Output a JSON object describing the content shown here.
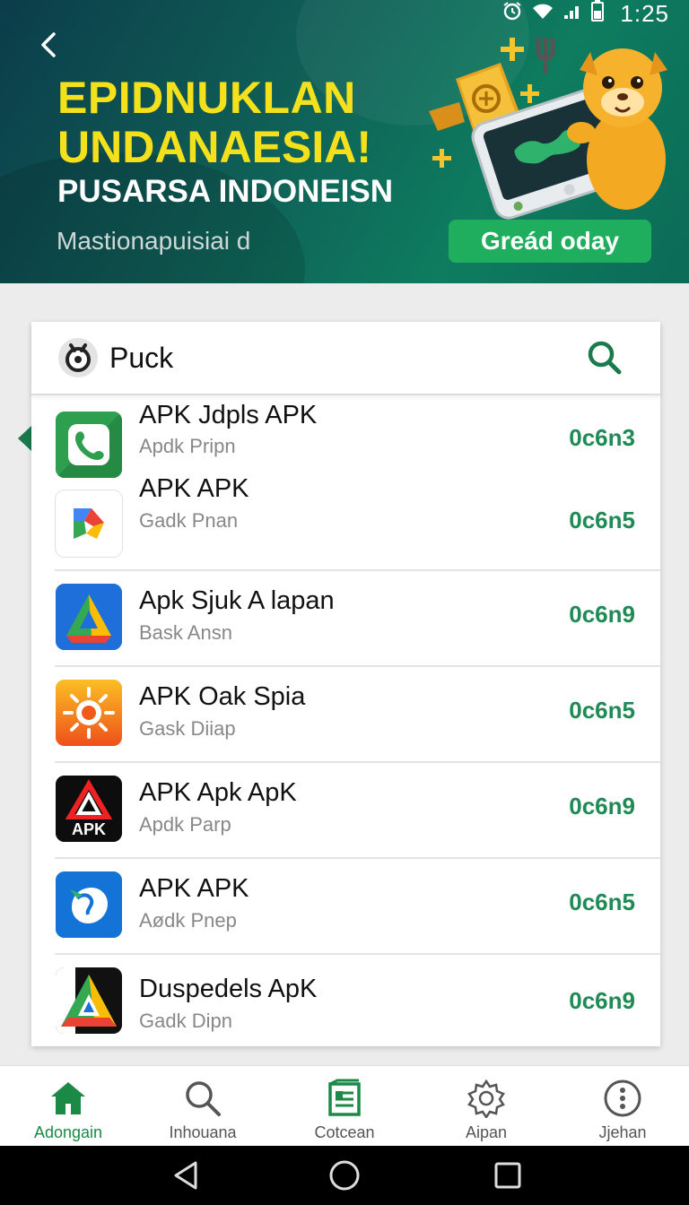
{
  "status_bar": {
    "time": "1:25",
    "icons": [
      "alarm-icon",
      "wifi-icon",
      "signal-icon",
      "battery-icon"
    ]
  },
  "banner": {
    "title_line1": "EPIDNUKLAN",
    "title_line2": "UNDANAESIA!",
    "subtitle": "PUSARSA INDONEISN",
    "tagline": "Mastionapuisiai d",
    "cta_label": "Greád oday",
    "colors": {
      "title": "#f4e11b",
      "cta": "#1fae5e",
      "background": "#0e6f5c"
    }
  },
  "search": {
    "value": "Puck"
  },
  "apps": [
    {
      "name": "APK Jdpls APK",
      "sub": "Apdk Pripn",
      "value": "0c6n3",
      "icon": "phone-app-icon"
    },
    {
      "name": "APK APK",
      "sub": "Gadk Pnan",
      "value": "0c6n5",
      "icon": "colorful-arrow-app-icon"
    },
    {
      "name": "Apk Sjuk A lapan",
      "sub": "Bask Ansn",
      "value": "0c6n9",
      "icon": "drive-triangle-app-icon"
    },
    {
      "name": "APK Oak Spia",
      "sub": "Gask Diiap",
      "value": "0c6n5",
      "icon": "sun-app-icon"
    },
    {
      "name": "APK Apk ApK",
      "sub": "Apdk Parp",
      "value": "0c6n9",
      "icon": "apk-logo-app-icon"
    },
    {
      "name": "APK APK",
      "sub": "Aødk Pnep",
      "value": "0c6n5",
      "icon": "map-app-icon"
    },
    {
      "name": "Duspedels ApK",
      "sub": "Gadk Dipn",
      "value": "0c6n9",
      "icon": "triangle-app-icon"
    }
  ],
  "bottom_nav": [
    {
      "label": "Adongain",
      "icon": "home-icon",
      "active": true
    },
    {
      "label": "Inhouana",
      "icon": "search-icon",
      "active": false
    },
    {
      "label": "Cotcean",
      "icon": "document-icon",
      "active": false
    },
    {
      "label": "Aipan",
      "icon": "settings-gear-icon",
      "active": false
    },
    {
      "label": "Jjehan",
      "icon": "more-dots-icon",
      "active": false
    }
  ],
  "accent_color": "#1f8a55"
}
